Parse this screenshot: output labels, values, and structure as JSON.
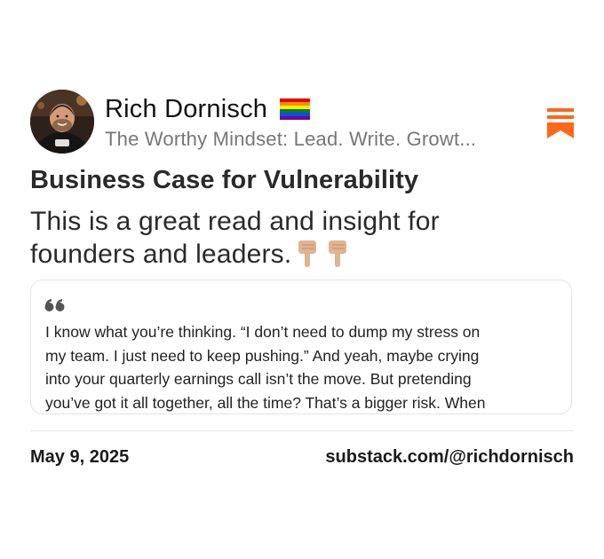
{
  "author": {
    "name": "Rich Dornisch",
    "flag_icon": "rainbow-flag-icon",
    "publication": "The Worthy Mindset: Lead. Write. Growt..."
  },
  "brand": {
    "logo_icon": "substack-logo-icon",
    "accent": "#ff6719"
  },
  "post": {
    "title": "Business Case for Vulnerability",
    "body_lines": [
      "This is a great read and insight for",
      "founders and leaders."
    ],
    "body_emoji_icon": "pointing-down-hand-icon"
  },
  "quote": {
    "quote_icon": "quote-mark-icon",
    "lines": [
      "I know what you’re thinking. “I don’t need to dump my stress on",
      "my team. I just need to keep pushing.” And yeah, maybe crying",
      "into your quarterly earnings call isn’t the move. But pretending",
      "you’ve got it all together, all the time? That’s a bigger risk. When"
    ]
  },
  "footer": {
    "date": "May 9, 2025",
    "url": "substack.com/@richdornisch"
  }
}
